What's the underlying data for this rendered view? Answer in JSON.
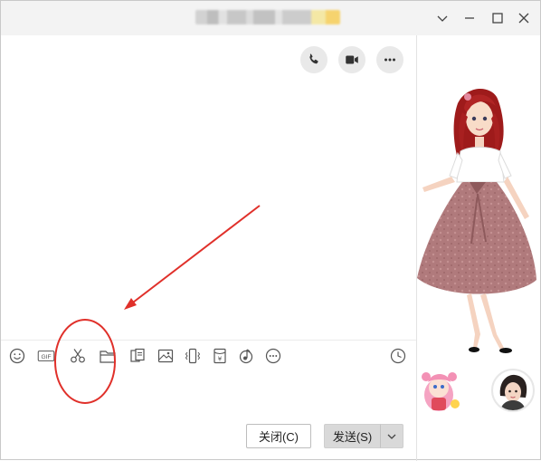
{
  "window": {
    "title_redacted": true,
    "controls": {
      "minimize": "chevron-down-icon",
      "restore": "minimize-icon",
      "maximize": "maximize-icon",
      "close": "close-icon"
    }
  },
  "chat_header": {
    "actions": [
      "phone-icon",
      "video-icon",
      "more-icon"
    ]
  },
  "toolbar": {
    "items": [
      "emoji-icon",
      "gif-icon",
      "scissors-icon",
      "folder-icon",
      "document-icon",
      "image-icon",
      "shake-icon",
      "red-packet-icon",
      "music-icon",
      "more-icon",
      "history-clock-icon"
    ],
    "gif_label": "GIF",
    "red_packet_symbol": "¥"
  },
  "footer": {
    "close_label": "关闭(C)",
    "send_label": "发送(S)"
  },
  "colors": {
    "annotation": "#e0302a",
    "titlebar": "#f3f3f3",
    "button_gray": "#d9d9d9"
  }
}
